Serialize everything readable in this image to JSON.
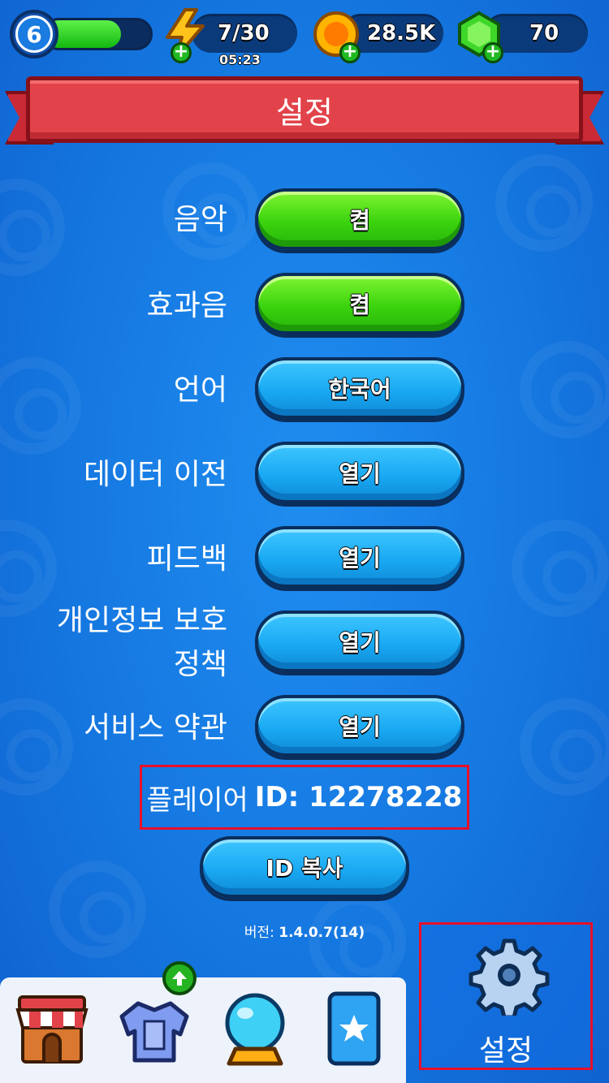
{
  "topbar": {
    "level": "6",
    "level_progress": 0.72,
    "energy": "7/30",
    "energy_timer": "05:23",
    "coins": "28.5K",
    "gems": "70"
  },
  "header": {
    "title": "설정"
  },
  "settings": {
    "rows": [
      {
        "label": "음악",
        "button": "켬",
        "style": "green"
      },
      {
        "label": "효과음",
        "button": "켬",
        "style": "green"
      },
      {
        "label": "언어",
        "button": "한국어",
        "style": "blue"
      },
      {
        "label": "데이터 이전",
        "button": "열기",
        "style": "blue"
      },
      {
        "label": "피드백",
        "button": "열기",
        "style": "blue"
      },
      {
        "label_line1": "개인정보 보호",
        "label_line2": "정책",
        "button": "열기",
        "style": "blue"
      },
      {
        "label": "서비스 약관",
        "button": "열기",
        "style": "blue"
      }
    ],
    "player_id_label": "플레이어",
    "player_id_value": "ID: 12278228",
    "copy_button": "ID 복사",
    "version_label": "버전:",
    "version_value": "1.4.0.7(14)"
  },
  "bottom_nav": {
    "items": [
      "shop-icon",
      "armor-icon",
      "crystal-ball-icon",
      "star-card-icon"
    ],
    "active_label": "설정",
    "active_icon": "gear-icon"
  },
  "colors": {
    "background": "#1577e0",
    "ribbon": "#e2434a",
    "button_green": "#3bd30e",
    "button_blue": "#1aa9f3",
    "highlight_border": "#e8102a"
  }
}
